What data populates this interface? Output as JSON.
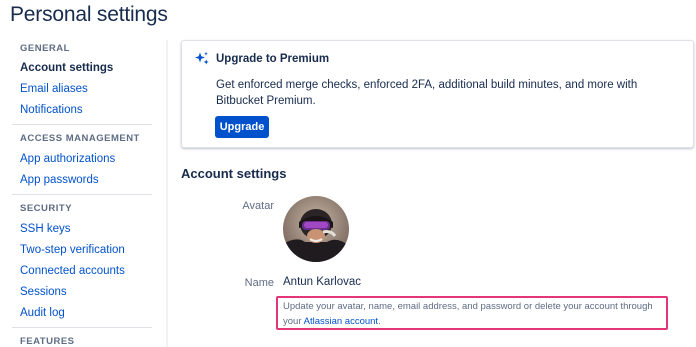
{
  "page": {
    "title": "Personal settings"
  },
  "sidebar": {
    "sections": [
      {
        "heading": "GENERAL",
        "items": [
          {
            "label": "Account settings"
          },
          {
            "label": "Email aliases"
          },
          {
            "label": "Notifications"
          }
        ]
      },
      {
        "heading": "ACCESS MANAGEMENT",
        "items": [
          {
            "label": "App authorizations"
          },
          {
            "label": "App passwords"
          }
        ]
      },
      {
        "heading": "SECURITY",
        "items": [
          {
            "label": "SSH keys"
          },
          {
            "label": "Two-step verification"
          },
          {
            "label": "Connected accounts"
          },
          {
            "label": "Sessions"
          },
          {
            "label": "Audit log"
          }
        ]
      },
      {
        "heading": "FEATURES",
        "items": []
      }
    ],
    "active_item": "Account settings"
  },
  "upgrade": {
    "icon": "sparkle-icon",
    "title": "Upgrade to Premium",
    "description": "Get enforced merge checks, enforced 2FA, additional build minutes, and more with Bitbucket Premium.",
    "button_label": "Upgrade"
  },
  "account": {
    "section_title": "Account settings",
    "avatar_label": "Avatar",
    "name_label": "Name",
    "name_value": "Antun Karlovac",
    "info_text": "Update your avatar, name, email address, and password or delete your account through your",
    "info_link": "Atlassian account",
    "info_suffix": "."
  },
  "colors": {
    "accent": "#0052cc",
    "text": "#172b4d",
    "subtle": "#5e6c84",
    "highlight_border": "#e4347a"
  }
}
